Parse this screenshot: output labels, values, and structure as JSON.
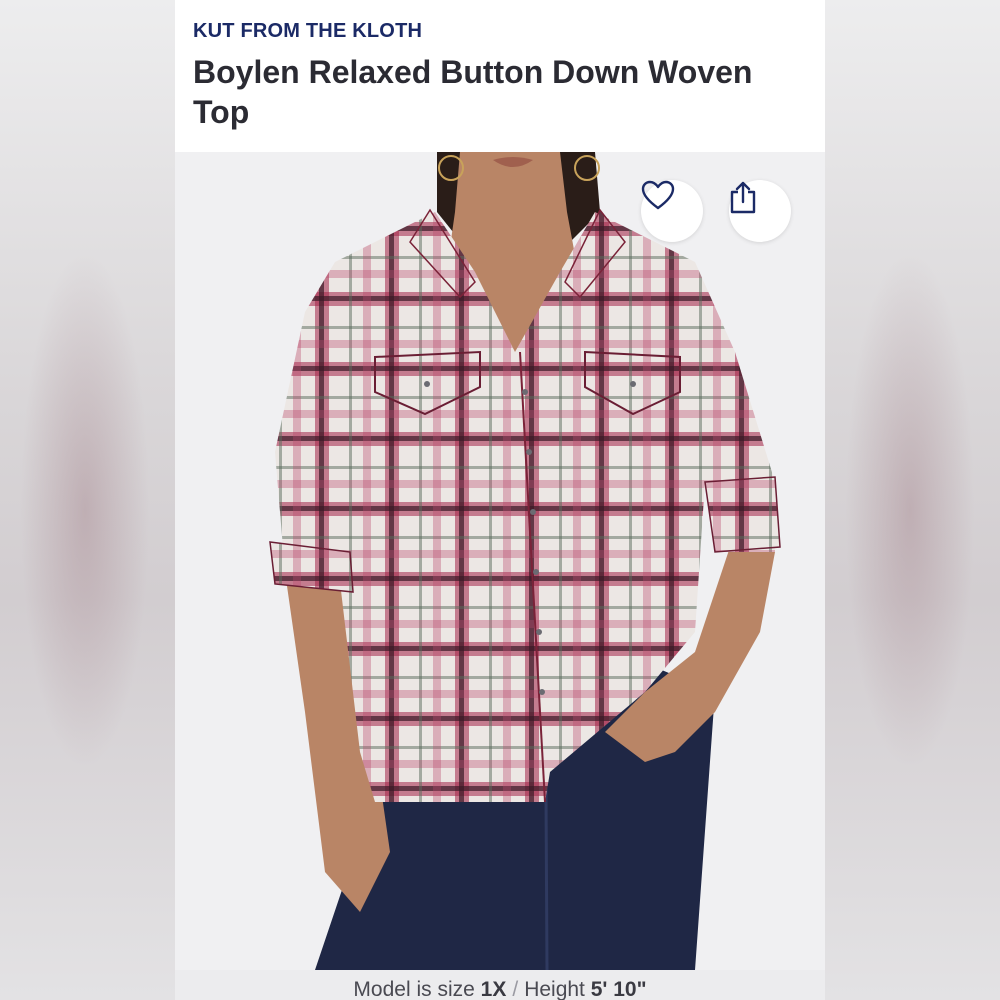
{
  "product": {
    "brand": "KUT FROM THE KLOTH",
    "title": "Boylen Relaxed Button Down Woven Top"
  },
  "actions": {
    "favorite_icon": "heart-icon",
    "share_icon": "share-icon"
  },
  "model_info": {
    "size_label": "Model is size",
    "size_value": "1X",
    "separator": "/",
    "height_label": "Height",
    "height_value": "5' 10\""
  },
  "colors": {
    "brand": "#1b2a66",
    "title": "#2b2b33",
    "plaid_red": "#8e1f3a",
    "denim": "#1f2745"
  }
}
